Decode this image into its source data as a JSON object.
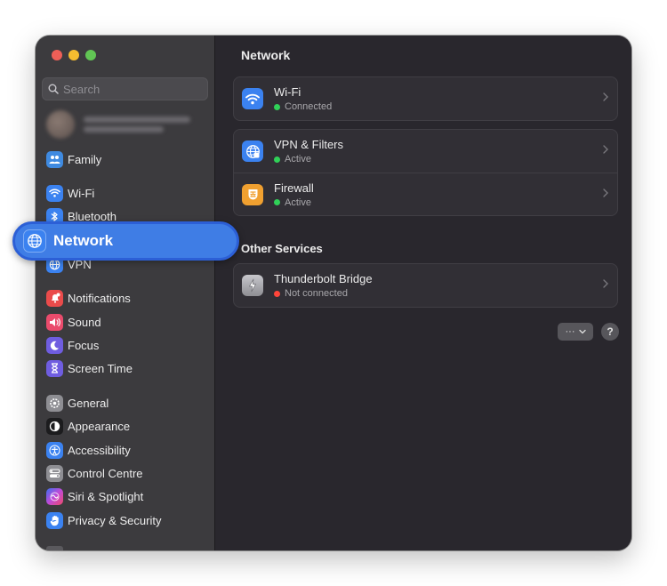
{
  "window": {
    "traffic_lights": [
      "#ee5f57",
      "#f4bd30",
      "#61c554"
    ]
  },
  "sidebar": {
    "search_placeholder": "Search",
    "items": [
      {
        "label": "Family",
        "icon": "family-icon",
        "color": "#3f8ae0"
      },
      {
        "label": "Wi-Fi",
        "icon": "wifi-icon",
        "color": "#3b82f0"
      },
      {
        "label": "Bluetooth",
        "icon": "bluetooth-icon",
        "color": "#3b82f0"
      },
      {
        "label": "VPN",
        "icon": "vpn-icon",
        "color": "#3b82f0"
      },
      {
        "label": "Notifications",
        "icon": "bell-icon",
        "color": "#ea4b4b"
      },
      {
        "label": "Sound",
        "icon": "speaker-icon",
        "color": "#ea4b6c"
      },
      {
        "label": "Focus",
        "icon": "moon-icon",
        "color": "#6f5de0"
      },
      {
        "label": "Screen Time",
        "icon": "hourglass-icon",
        "color": "#6f5de0"
      },
      {
        "label": "General",
        "icon": "gear-icon",
        "color": "#8e8e93"
      },
      {
        "label": "Appearance",
        "icon": "appearance-icon",
        "color": "#1c1c1e"
      },
      {
        "label": "Accessibility",
        "icon": "accessibility-icon",
        "color": "#3b82f0"
      },
      {
        "label": "Control Centre",
        "icon": "control-centre-icon",
        "color": "#8e8e93"
      },
      {
        "label": "Siri & Spotlight",
        "icon": "siri-icon",
        "color": "#a04ad8"
      },
      {
        "label": "Privacy & Security",
        "icon": "hand-icon",
        "color": "#3b82f0"
      }
    ]
  },
  "highlight": {
    "label": "Network",
    "icon": "globe-icon",
    "color": "#3f7de5"
  },
  "main": {
    "title": "Network",
    "services": [
      {
        "title": "Wi-Fi",
        "status": "Connected",
        "status_color": "#30d158",
        "icon": "wifi-icon",
        "icon_color": "#3b82f0"
      },
      {
        "title": "VPN & Filters",
        "status": "Active",
        "status_color": "#30d158",
        "icon": "globe-icon",
        "icon_color": "#3b82f0"
      },
      {
        "title": "Firewall",
        "status": "Active",
        "status_color": "#30d158",
        "icon": "firewall-icon",
        "icon_color": "#f0a030"
      }
    ],
    "other_services_label": "Other Services",
    "other_services": [
      {
        "title": "Thunderbolt Bridge",
        "status": "Not connected",
        "status_color": "#ff453a",
        "icon": "thunderbolt-icon",
        "icon_color": "#8e8e93"
      }
    ],
    "more_button": "···",
    "help_button": "?"
  }
}
